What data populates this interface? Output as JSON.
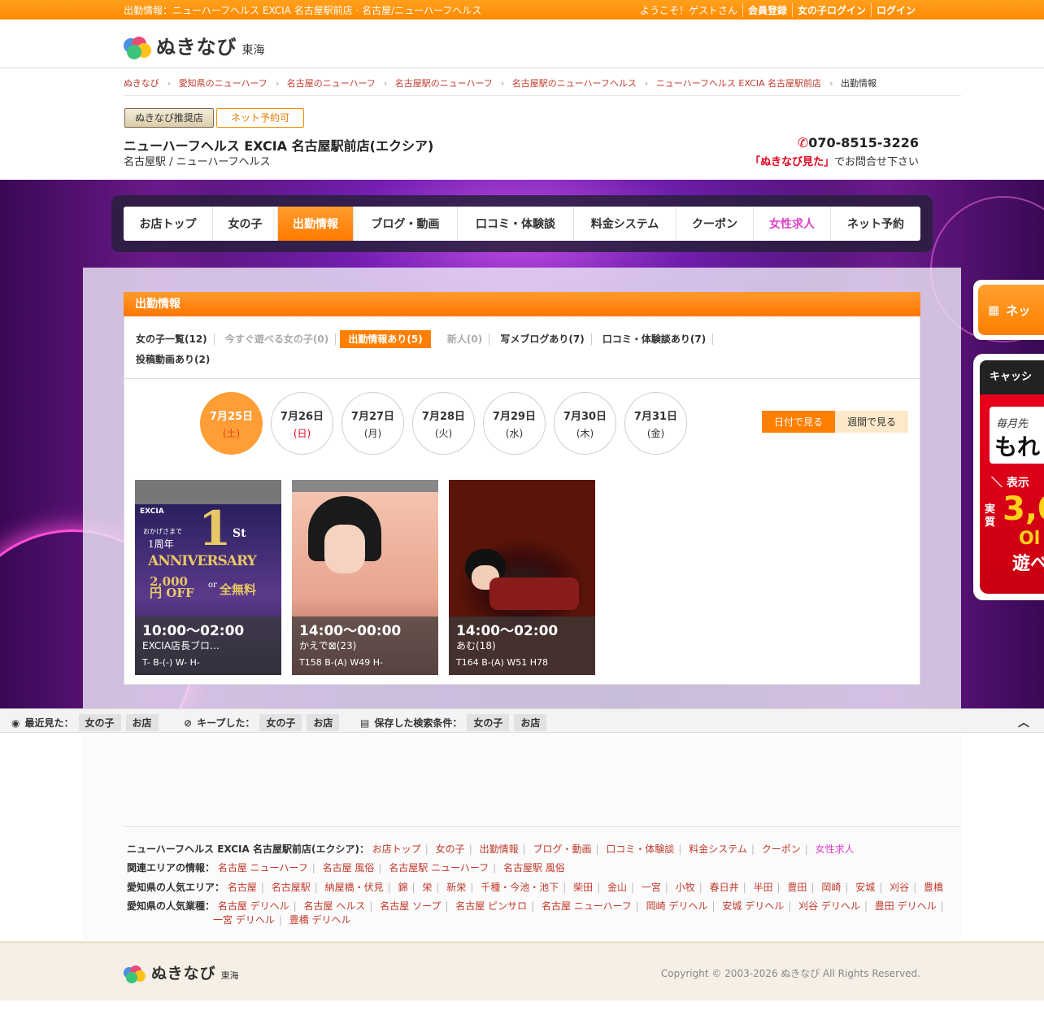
{
  "topbar": {
    "left": "出勤情報：ニューハーフヘルス EXCIA 名古屋駅前店 · 名古屋/ニューハーフヘルス",
    "welcome": "ようこそ！ゲストさん",
    "register": "会員登録",
    "girl_login": "女の子ログイン",
    "login": "ログイン"
  },
  "logo": {
    "name": "ぬきなび",
    "area": "東海"
  },
  "breadcrumb": [
    "ぬきなび",
    "愛知県のニューハーフ",
    "名古屋のニューハーフ",
    "名古屋駅のニューハーフ",
    "名古屋駅のニューハーフヘルス",
    "ニューハーフヘルス EXCIA 名古屋駅前店",
    "出勤情報"
  ],
  "badges": {
    "recommended": "ぬきなび推奨店",
    "net_reserve": "ネット予約可"
  },
  "shop": {
    "name": "ニューハーフヘルス EXCIA 名古屋駅前店(エクシア)",
    "sub": "名古屋駅 / ニューハーフヘルス",
    "tel": "070-8515-3226",
    "tel_note_em": "「ぬきなび見た」",
    "tel_note": "でお問合せ下さい"
  },
  "nav": [
    {
      "label": "お店トップ"
    },
    {
      "label": "女の子"
    },
    {
      "label": "出勤情報"
    },
    {
      "label": "ブログ・動画"
    },
    {
      "label": "口コミ・体験談"
    },
    {
      "label": "料金システム"
    },
    {
      "label": "クーポン"
    },
    {
      "label": "女性求人"
    },
    {
      "label": "ネット予約"
    }
  ],
  "section_title": "出勤情報",
  "tabs": {
    "t1": "女の子一覧(12)",
    "t2": "今すぐ遊べる女の子(0)",
    "t3": "出勤情報あり(5)",
    "t4": "新人(0)",
    "t5": "写メブログあり(7)",
    "t6": "口コミ・体験談あり(7)",
    "t7": "投稿動画あり(2)"
  },
  "dates": [
    {
      "d": "7月25日",
      "w": "(土)"
    },
    {
      "d": "7月26日",
      "w": "(日)"
    },
    {
      "d": "7月27日",
      "w": "(月)"
    },
    {
      "d": "7月28日",
      "w": "(火)"
    },
    {
      "d": "7月29日",
      "w": "(水)"
    },
    {
      "d": "7月30日",
      "w": "(木)"
    },
    {
      "d": "7月31日",
      "w": "(金)"
    }
  ],
  "view": {
    "by_date": "日付で見る",
    "by_week": "週間で見る"
  },
  "girls": [
    {
      "time": "10:00〜02:00",
      "name": "EXCIA店長ブロ…",
      "size": "T- B-(-) W- H-",
      "banner": {
        "brand": "EXCIA",
        "big": "1",
        "line1": "おかげさまで",
        "line2": "1周年",
        "title": "ANNIVERSARY",
        "st": "St",
        "offer1": "2,000円 OFF",
        "or": "or",
        "offer2": "全無料"
      }
    },
    {
      "time": "14:00〜00:00",
      "name": "かえで⊠(23)",
      "size": "T158 B-(A) W49 H-"
    },
    {
      "time": "14:00〜02:00",
      "name": "あむ(18)",
      "size": "T164 B-(A) W51 H78"
    }
  ],
  "side": {
    "reserve": "ネッ",
    "cash_head": "キャッシ",
    "cash_t1": "毎月先",
    "cash_t2": "もれ",
    "cash_t3": "＼ 表示",
    "cash_t4": "実",
    "cash_t5": "質",
    "cash_t6": "3,0",
    "cash_t7": "Ol",
    "cash_t8": "遊べ"
  },
  "recent": {
    "label1": "最近見た：",
    "girl1": "女の子",
    "shop1": "お店",
    "label2": "キープした：",
    "girl2": "女の子",
    "shop2": "お店",
    "label3": "保存した検索条件：",
    "girl3": "女の子",
    "shop3": "お店"
  },
  "footer": {
    "row1_label": "ニューハーフヘルス EXCIA 名古屋駅前店(エクシア)：",
    "row1": [
      "お店トップ",
      "女の子",
      "出勤情報",
      "ブログ・動画",
      "口コミ・体験談",
      "料金システム",
      "クーポン",
      "女性求人"
    ],
    "row2_label": "関連エリアの情報：",
    "row2": [
      "名古屋 ニューハーフ",
      "名古屋 風俗",
      "名古屋駅 ニューハーフ",
      "名古屋駅 風俗"
    ],
    "row3_label": "愛知県の人気エリア：",
    "row3": [
      "名古屋",
      "名古屋駅",
      "納屋橋・伏見",
      "錦",
      "栄",
      "新栄",
      "千種・今池・池下",
      "柴田",
      "金山",
      "一宮",
      "小牧",
      "春日井",
      "半田",
      "豊田",
      "岡崎",
      "安城",
      "刈谷",
      "豊橋"
    ],
    "row4_label": "愛知県の人気業種：",
    "row4": [
      "名古屋 デリヘル",
      "名古屋 ヘルス",
      "名古屋 ソープ",
      "名古屋 ピンサロ",
      "名古屋 ニューハーフ",
      "岡崎 デリヘル",
      "安城 デリヘル",
      "刈谷 デリヘル",
      "豊田 デリヘル"
    ],
    "row5": [
      "一宮 デリヘル",
      "豊橋 デリヘル"
    ]
  },
  "copyright": "Copyright © 2003-2026 ぬきなび All Rights Reserved.",
  "colors": {
    "accent": "#ff7f00",
    "pink": "#e040c8",
    "red": "#e0001b"
  }
}
